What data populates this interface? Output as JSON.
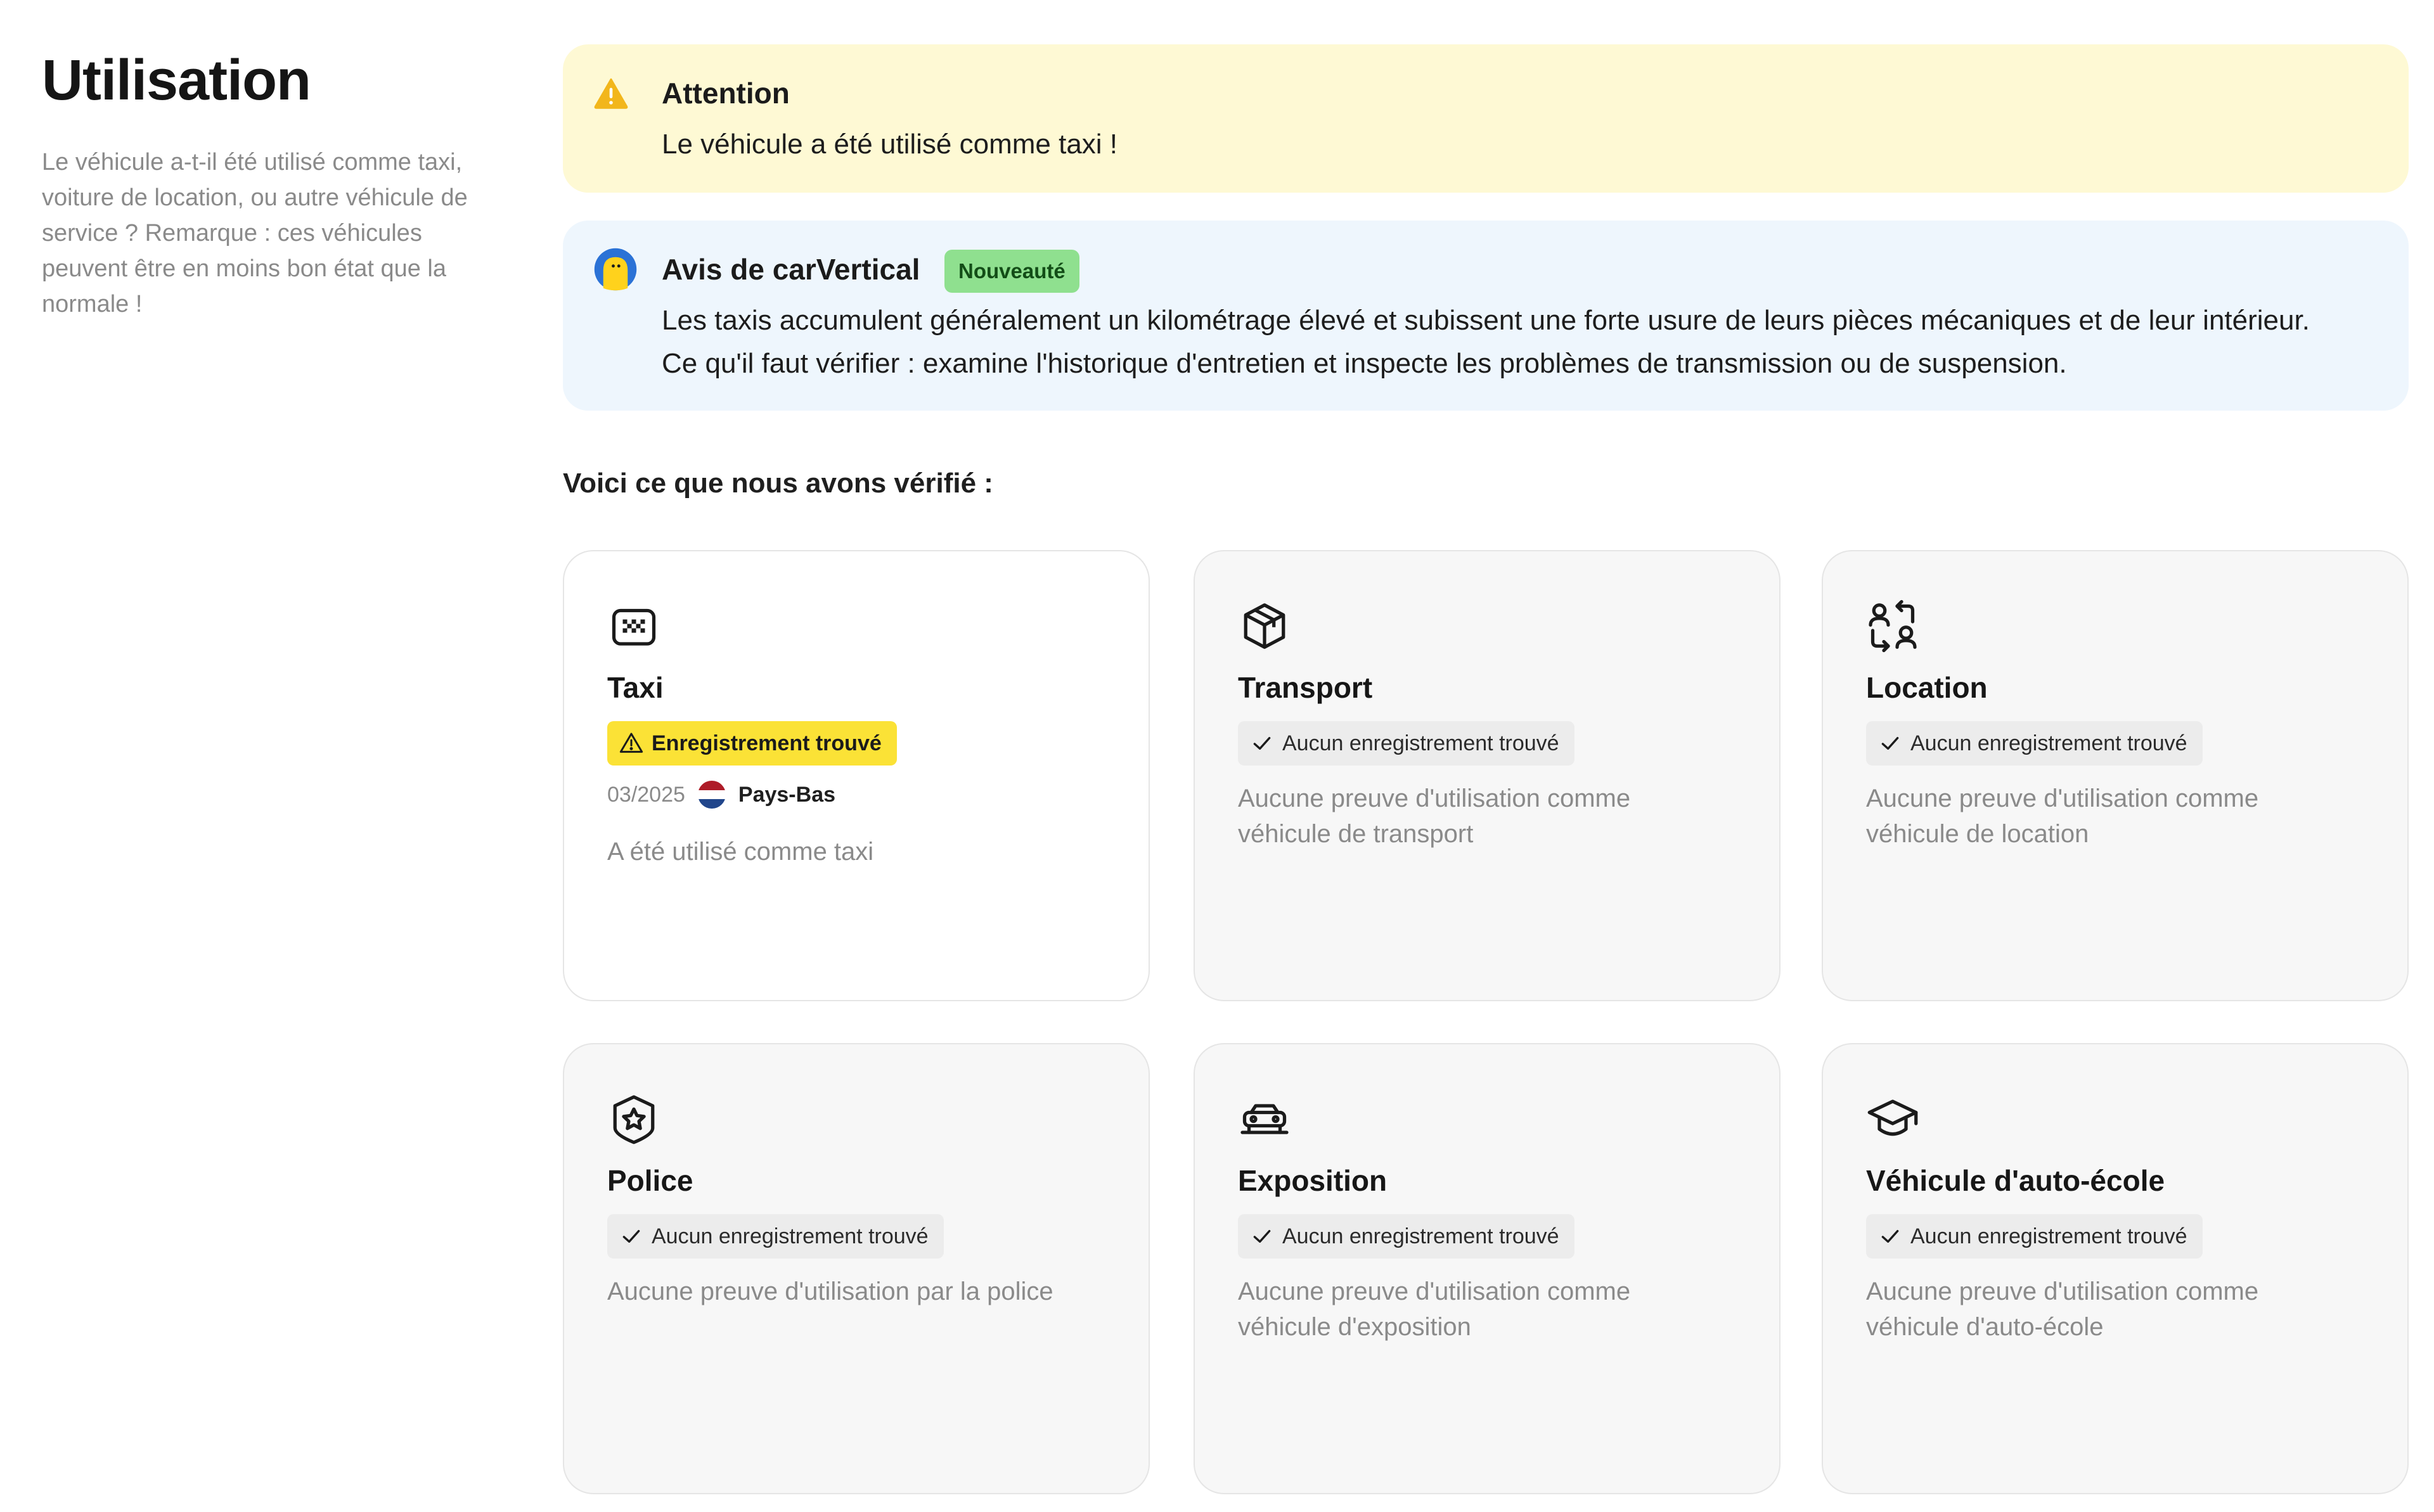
{
  "intro": {
    "title": "Utilisation",
    "description": "Le véhicule a-t-il été utilisé comme taxi, voiture de location, ou autre véhicule de service ? Remarque : ces véhicules peuvent être en moins bon état que la normale !"
  },
  "warning_alert": {
    "icon": "warning-triangle-icon",
    "title": "Attention",
    "text": "Le véhicule a été utilisé comme taxi !",
    "color": "#fef9d4"
  },
  "info_alert": {
    "icon": "carvertical-logo-icon",
    "title": "Avis de carVertical",
    "badge": "Nouveauté",
    "text": "Les taxis accumulent généralement un kilométrage élevé et subissent une forte usure de leurs pièces mécaniques et de leur intérieur. Ce qu'il faut vérifier : examine l'historique d'entretien et inspecte les problèmes de transmission ou de suspension.",
    "color": "#eef6fd"
  },
  "checks_heading": "Voici ce que nous avons vérifié :",
  "cards": [
    {
      "icon": "taxi-sign-icon",
      "title": "Taxi",
      "status": "Enregistrement trouvé",
      "status_type": "found",
      "date": "03/2025",
      "country": "Pays-Bas",
      "country_flag": "netherlands-flag-icon",
      "description": "A été utilisé comme taxi"
    },
    {
      "icon": "package-box-icon",
      "title": "Transport",
      "status": "Aucun enregistrement trouvé",
      "status_type": "none",
      "description": "Aucune preuve d'utilisation comme véhicule de transport"
    },
    {
      "icon": "user-swap-icon",
      "title": "Location",
      "status": "Aucun enregistrement trouvé",
      "status_type": "none",
      "description": "Aucune preuve d'utilisation comme véhicule de location"
    },
    {
      "icon": "police-shield-icon",
      "title": "Police",
      "status": "Aucun enregistrement trouvé",
      "status_type": "none",
      "description": "Aucune preuve d'utilisation par la police"
    },
    {
      "icon": "car-display-icon",
      "title": "Exposition",
      "status": "Aucun enregistrement trouvé",
      "status_type": "none",
      "description": "Aucune preuve d'utilisation comme véhicule d'exposition"
    },
    {
      "icon": "graduation-cap-icon",
      "title": "Véhicule d'auto-école",
      "status": "Aucun enregistrement trouvé",
      "status_type": "none",
      "description": "Aucune preuve d'utilisation comme véhicule d'auto-école"
    }
  ],
  "colors": {
    "found_badge": "#fbe236",
    "new_badge": "#8fe08f",
    "card_inactive": "#f7f7f7",
    "card_active": "#ffffff"
  }
}
